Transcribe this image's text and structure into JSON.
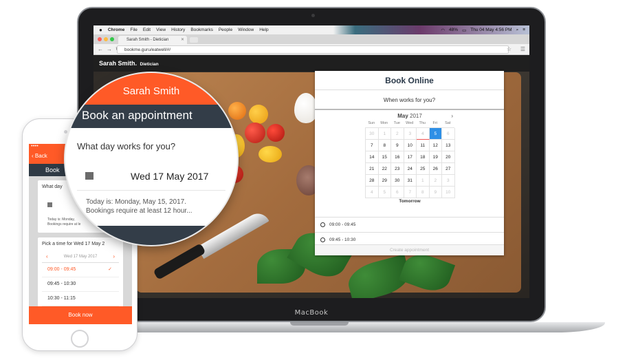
{
  "mac_menubar": {
    "apple": "",
    "items": [
      "Chrome",
      "File",
      "Edit",
      "View",
      "History",
      "Bookmarks",
      "People",
      "Window",
      "Help"
    ],
    "battery": "48%",
    "clock": "Thu 04 May  4:56 PM"
  },
  "browser": {
    "tab_title": "Sarah Smith - Dietician",
    "url": "bookme.guru/eatwell/#/"
  },
  "site": {
    "owner_name": "Sarah Smith.",
    "owner_role": "Dietician",
    "book_panel": {
      "title": "Book Online",
      "subtitle": "When works for you?",
      "calendar": {
        "month": "May",
        "year": "2017",
        "weekdays": [
          "Sun",
          "Mon",
          "Tue",
          "Wed",
          "Thu",
          "Fri",
          "Sat"
        ],
        "days": [
          "30",
          "1",
          "2",
          "3",
          "4",
          "5",
          "6",
          "7",
          "8",
          "9",
          "10",
          "11",
          "12",
          "13",
          "14",
          "15",
          "16",
          "17",
          "18",
          "19",
          "20",
          "21",
          "22",
          "23",
          "24",
          "25",
          "26",
          "27",
          "28",
          "29",
          "30",
          "31",
          "1",
          "2",
          "3",
          "4",
          "5",
          "6",
          "7",
          "8",
          "9",
          "10"
        ],
        "selected_day": "5",
        "today_day": "4"
      },
      "selected_label": "Tomorrow",
      "time_slots": [
        "09:00 - 09:45",
        "09:45 - 10:30"
      ],
      "create_button": "Create appointment"
    }
  },
  "laptop_brand": "MacBook",
  "phone": {
    "back": "Back",
    "page_title": "Book",
    "question": "What day",
    "note_line1": "Today is: Monday,",
    "note_line2": "Bookings require at le",
    "time_question": "Pick a time for Wed 17 May 2",
    "day_nav": "Wed 17 May 2017",
    "slots": [
      "09:00 - 09:45",
      "09:45 - 10:30",
      "10:30 - 11:15"
    ],
    "book_button": "Book now"
  },
  "magnifier": {
    "name": "Sarah Smith",
    "title": "Book an appointment",
    "question": "What day works for you?",
    "date": "Wed 17 May 2017",
    "note_line1": "Today is: Monday, May 15, 2017.",
    "note_line2": "Bookings require at least 12 hour..."
  },
  "colors": {
    "brand_orange": "#ff5a27",
    "dark_slate": "#333d48",
    "calendar_selected": "#2e8fe6"
  }
}
